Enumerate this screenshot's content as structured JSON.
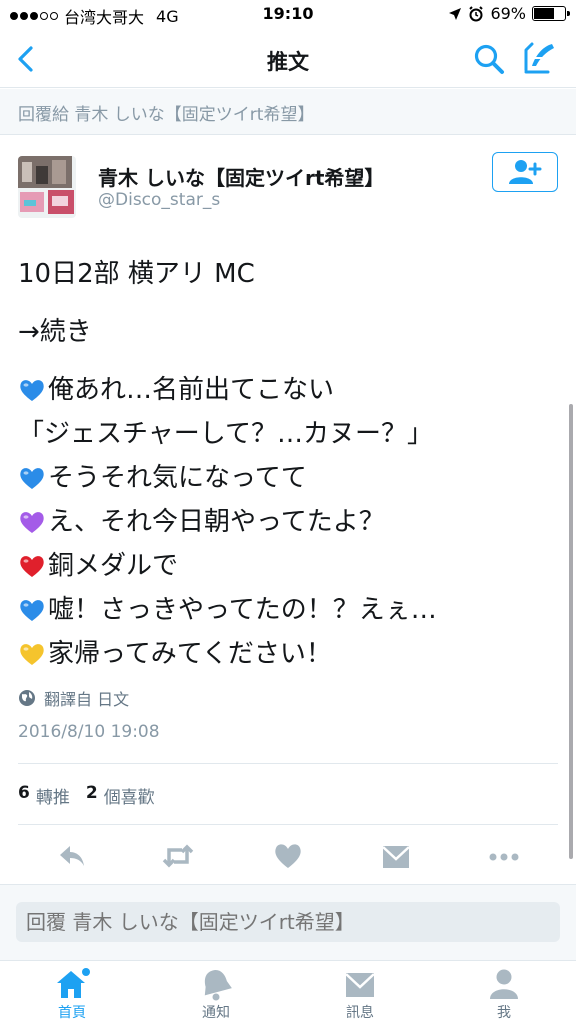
{
  "status_bar": {
    "carrier": "台湾大哥大",
    "network": "4G",
    "time": "19:10",
    "battery_percent": "69%",
    "battery_level": 0.69
  },
  "nav": {
    "title": "推文",
    "back_icon": "chevron-left-icon",
    "search_icon": "search-icon",
    "compose_icon": "compose-icon"
  },
  "reply_context": "回覆給 青木 しいな【固定ツイrt希望】",
  "author": {
    "name": "青木 しいな【固定ツイrt希望】",
    "handle": "@Disco_star_s",
    "follow_icon": "add-user-icon"
  },
  "tweet": {
    "line1": "10日2部 横アリ MC",
    "line2": "→続き",
    "dialogue": [
      {
        "heart_color": "#2b8ce8",
        "text": "俺あれ…名前出てこない"
      },
      {
        "heart_color": "",
        "text": "「ジェスチャーして？…カヌー？」"
      },
      {
        "heart_color": "#2b8ce8",
        "text": "そうそれ気になってて"
      },
      {
        "heart_color": "#a45be8",
        "text": "え、それ今日朝やってたよ？"
      },
      {
        "heart_color": "#e0202c",
        "text": "銅メダルで"
      },
      {
        "heart_color": "#2b8ce8",
        "text": "嘘！さっきやってたの！？えぇ…"
      },
      {
        "heart_color": "#f5c42d",
        "text": "家帰ってみてください！"
      }
    ]
  },
  "translation": {
    "label": "翻譯自 日文",
    "icon": "globe-icon"
  },
  "timestamp": "2016/8/10 19:08",
  "stats": {
    "retweet_count": "6",
    "retweet_label": "轉推",
    "like_count": "2",
    "like_label": "個喜歡"
  },
  "actions": [
    "reply-icon",
    "retweet-icon",
    "heart-icon",
    "dm-icon",
    "more-icon"
  ],
  "reply_box": {
    "placeholder": "回覆 青木 しいな【固定ツイrt希望】"
  },
  "tabs": [
    {
      "label": "首頁",
      "icon": "home-icon",
      "active": true
    },
    {
      "label": "通知",
      "icon": "bell-icon",
      "active": false
    },
    {
      "label": "訊息",
      "icon": "envelope-icon",
      "active": false
    },
    {
      "label": "我",
      "icon": "person-icon",
      "active": false
    }
  ],
  "colors": {
    "accent": "#1da1f2",
    "muted": "#8899a6",
    "icon_gray": "#aab8c2"
  }
}
